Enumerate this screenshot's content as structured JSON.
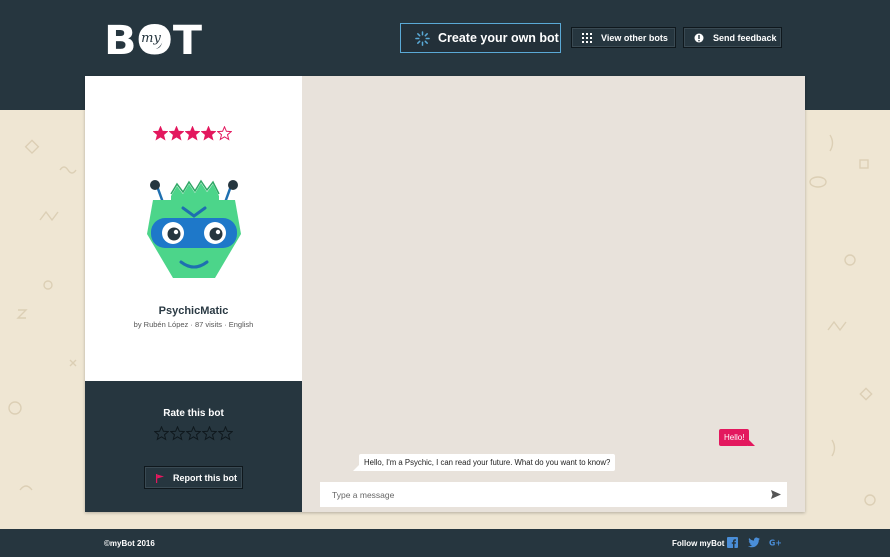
{
  "header": {
    "logo_word": "BOT",
    "logo_small": "my",
    "create_label": "Create your own bot",
    "view_label": "View other bots",
    "feedback_label": "Send feedback"
  },
  "bot": {
    "rating": 4,
    "rating_max": 5,
    "name": "PsychicMatic",
    "meta": "by Rubén López · 87 visits · English"
  },
  "rate": {
    "title": "Rate this bot",
    "report_label": "Report this bot"
  },
  "chat": {
    "messages": [
      {
        "from": "user",
        "text": "Hello!"
      },
      {
        "from": "bot",
        "text": "Hello, I'm a Psychic, I can read your future. What do you want to know?"
      }
    ],
    "input_value": "",
    "input_placeholder": "Type a message"
  },
  "footer": {
    "copyright": "©myBot 2016",
    "follow_label": "Follow myBot",
    "social": [
      "facebook-icon",
      "twitter-icon",
      "google-plus-icon"
    ]
  },
  "colors": {
    "header_bg": "#26363f",
    "accent_pink": "#e3185e",
    "accent_blue": "#5aa9d6",
    "page_bg": "#efe6d3",
    "chat_bg": "#e8e2db"
  }
}
